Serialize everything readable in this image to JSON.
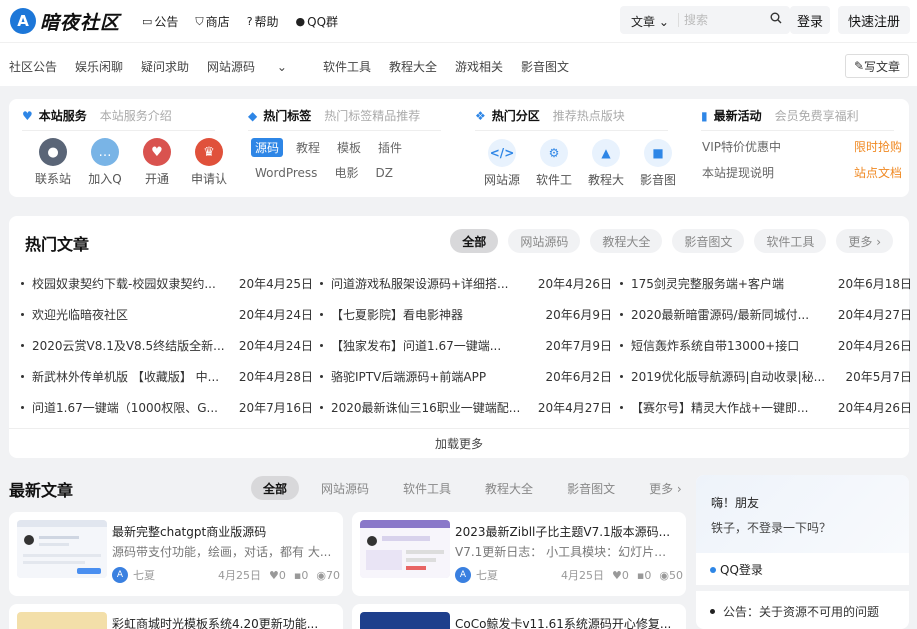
{
  "header": {
    "logo_text": "暗夜社区",
    "logo_mark": "A",
    "nav": [
      {
        "icon": "▭",
        "icon_name": "announcement-icon",
        "label": "公告"
      },
      {
        "icon": "⛉",
        "icon_name": "cart-icon",
        "label": "商店"
      },
      {
        "icon": "?",
        "icon_name": "help-icon",
        "label": "帮助"
      },
      {
        "icon": "●",
        "icon_name": "qq-icon",
        "label": "QQ群"
      }
    ],
    "search": {
      "category": "文章",
      "placeholder": "搜索",
      "value": ""
    },
    "login_label": "登录",
    "register_label": "快速注册"
  },
  "subnav": {
    "items": [
      "社区公告",
      "娱乐闲聊",
      "疑问求助",
      "网站源码",
      "软件工具",
      "教程大全",
      "游戏相关",
      "影音图文"
    ],
    "write_label": "写文章"
  },
  "services": {
    "title": "本站服务",
    "subtitle": "本站服务介绍",
    "items": [
      {
        "label": "联系站",
        "color": "#5a6577",
        "glyph": "●"
      },
      {
        "label": "加入Q",
        "color": "#79b4e6",
        "glyph": "…"
      },
      {
        "label": "开通",
        "color": "#d9534f",
        "glyph": "♥"
      },
      {
        "label": "申请认",
        "color": "#e0513b",
        "glyph": "♛"
      }
    ]
  },
  "hot_tags": {
    "title": "热门标签",
    "subtitle": "热门标签精品推荐",
    "tags": [
      "源码",
      "教程",
      "模板",
      "插件",
      "WordPress",
      "电影",
      "DZ"
    ]
  },
  "hot_zones": {
    "title": "热门分区",
    "subtitle": "推荐热点版块",
    "items": [
      {
        "label": "网站源",
        "glyph": "</>"
      },
      {
        "label": "软件工",
        "glyph": "⚙"
      },
      {
        "label": "教程大",
        "glyph": "▲"
      },
      {
        "label": "影音图",
        "glyph": "■"
      }
    ]
  },
  "activities": {
    "title": "最新活动",
    "subtitle": "会员免费享福利",
    "items": [
      {
        "label": "VIP特价优惠中",
        "badge": "限时抢购"
      },
      {
        "label": "本站提现说明",
        "badge": "站点文档"
      }
    ]
  },
  "hot_articles": {
    "title": "热门文章",
    "tabs": [
      "全部",
      "网站源码",
      "教程大全",
      "影音图文",
      "软件工具",
      "更多 ›"
    ],
    "columns": [
      [
        {
          "title": "校园奴隶契约下载-校园奴隶契约...",
          "date": "20年4月25日"
        },
        {
          "title": "欢迎光临暗夜社区",
          "date": "20年4月24日"
        },
        {
          "title": "2020云赏V8.1及V8.5终结版全新...",
          "date": "20年4月24日"
        },
        {
          "title": "新武林外传单机版 【收藏版】 中...",
          "date": "20年4月28日"
        },
        {
          "title": "问道1.67一键端（1000权限、G...",
          "date": "20年7月16日"
        }
      ],
      [
        {
          "title": "问道游戏私服架设源码+详细搭...",
          "date": "20年4月26日"
        },
        {
          "title": "【七夏影院】看电影神器",
          "date": "20年6月9日"
        },
        {
          "title": "【独家发布】问道1.67一键端...",
          "date": "20年7月9日"
        },
        {
          "title": "骆驼IPTV后端源码+前端APP",
          "date": "20年6月2日"
        },
        {
          "title": "2020最新诛仙三16职业一键端配...",
          "date": "20年4月27日"
        }
      ],
      [
        {
          "title": "175剑灵完整服务端+客户端",
          "date": "20年6月18日"
        },
        {
          "title": "2020最新暗雷源码/最新同城付...",
          "date": "20年4月27日"
        },
        {
          "title": "短信轰炸系统自带13000+接口",
          "date": "20年4月26日"
        },
        {
          "title": "2019优化版导航源码|自动收录|秘...",
          "date": "20年5月7日"
        },
        {
          "title": "【赛尔号】精灵大作战+一键即...",
          "date": "20年4月26日"
        }
      ]
    ],
    "load_more": "加载更多"
  },
  "latest": {
    "title": "最新文章",
    "tabs": [
      "全部",
      "网站源码",
      "软件工具",
      "教程大全",
      "影音图文",
      "更多 ›"
    ],
    "cards": [
      {
        "title": "最新完整chatgpt商业版源码",
        "desc": "源码带支付功能，绘画，对话，都有 大...",
        "author": "七夏",
        "date": "4月25日",
        "likes": "0",
        "comments": "0",
        "views": "70"
      },
      {
        "title": "2023最新Zibll子比主题V7.1版本源码...",
        "desc": "V7.1更新日志： 小工具模块：幻灯片模...",
        "author": "七夏",
        "date": "4月25日",
        "likes": "0",
        "comments": "0",
        "views": "50"
      },
      {
        "title": "彩虹商城时光模板系统4.20更新功能...",
        "desc": "",
        "author": "",
        "date": "",
        "likes": "",
        "comments": "",
        "views": ""
      },
      {
        "title": "CoCo鲸发卡v11.61系统源码开心修复...",
        "desc": "",
        "author": "",
        "date": "",
        "likes": "",
        "comments": "",
        "views": ""
      }
    ]
  },
  "aside": {
    "greeting": "嗨！朋友",
    "prompt": "铁子，不登录一下吗？",
    "qq_login": "QQ登录",
    "notice": "公告：关于资源不可用的问题"
  },
  "colors": {
    "accent": "#2e86e6",
    "badge": "#f08a24",
    "background": "#f1f2f4"
  }
}
